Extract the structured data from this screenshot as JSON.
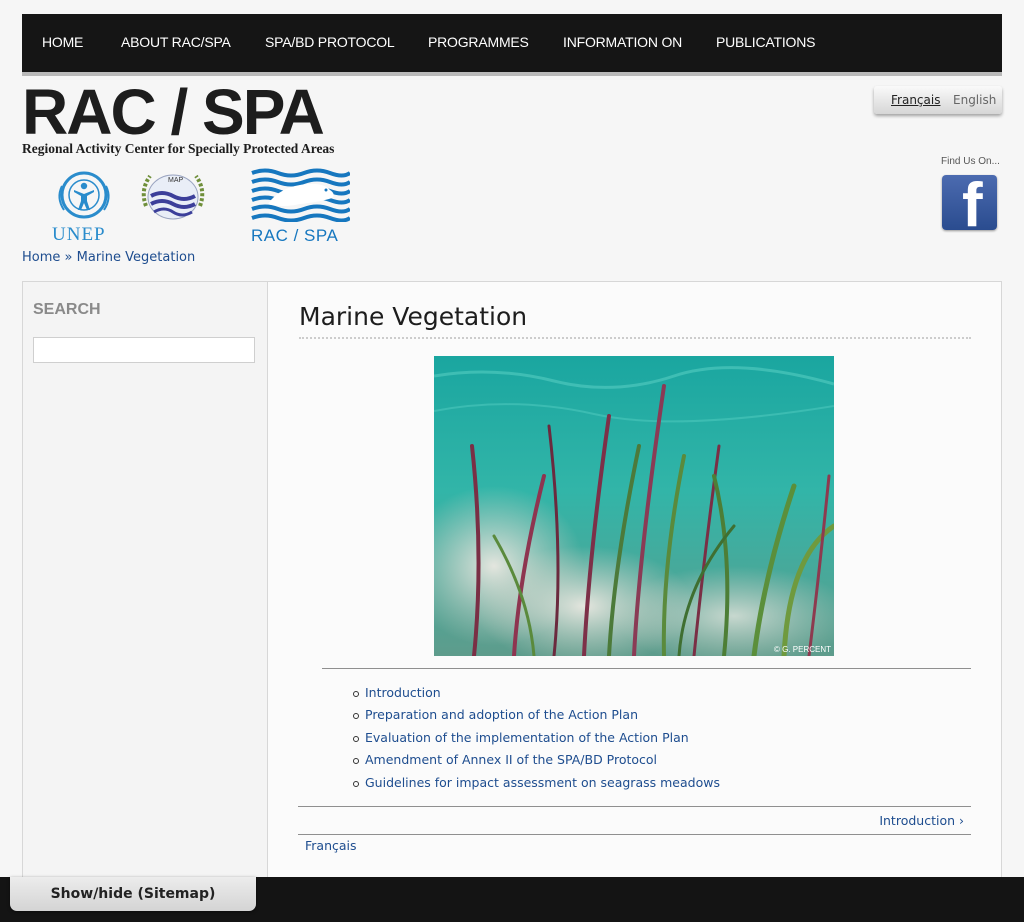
{
  "nav": {
    "items": [
      {
        "label": "HOME"
      },
      {
        "label": "ABOUT RAC/SPA"
      },
      {
        "label": "SPA/BD PROTOCOL"
      },
      {
        "label": "PROGRAMMES"
      },
      {
        "label": "INFORMATION ON"
      },
      {
        "label": "PUBLICATIONS"
      }
    ]
  },
  "header": {
    "brand": "RAC / SPA",
    "brand_subtitle": "Regional Activity Center for Specially Protected Areas",
    "logos": {
      "unep": "UNEP",
      "map": "MAP",
      "racspa": "RAC / SPA"
    },
    "languages": [
      {
        "label": "Français",
        "active": true
      },
      {
        "label": "English",
        "active": false
      }
    ],
    "find_us": "Find Us On...",
    "facebook_glyph": "f"
  },
  "breadcrumb": {
    "home": "Home",
    "separator": "»",
    "current": "Marine Vegetation"
  },
  "sidebar": {
    "search_title": "SEARCH",
    "search_value": ""
  },
  "main": {
    "title": "Marine Vegetation",
    "photo_credit": "© G. PERCENT",
    "toc": [
      {
        "label": "Introduction"
      },
      {
        "label": "Preparation and adoption of the Action Plan"
      },
      {
        "label": "Evaluation of the implementation of the Action Plan"
      },
      {
        "label": "Amendment of Annex II of the SPA/BD Protocol"
      },
      {
        "label": "Guidelines for impact assessment on seagrass meadows"
      }
    ],
    "next_link": "Introduction ›",
    "translation_link": "Français"
  },
  "footer": {
    "sitemap_toggle": "Show/hide (Sitemap)"
  },
  "colors": {
    "nav_bg": "#151515",
    "link": "#1e4d8f",
    "unep_blue": "#2a8ccc",
    "racspa_blue": "#1677bf",
    "facebook": "#3b5998"
  }
}
